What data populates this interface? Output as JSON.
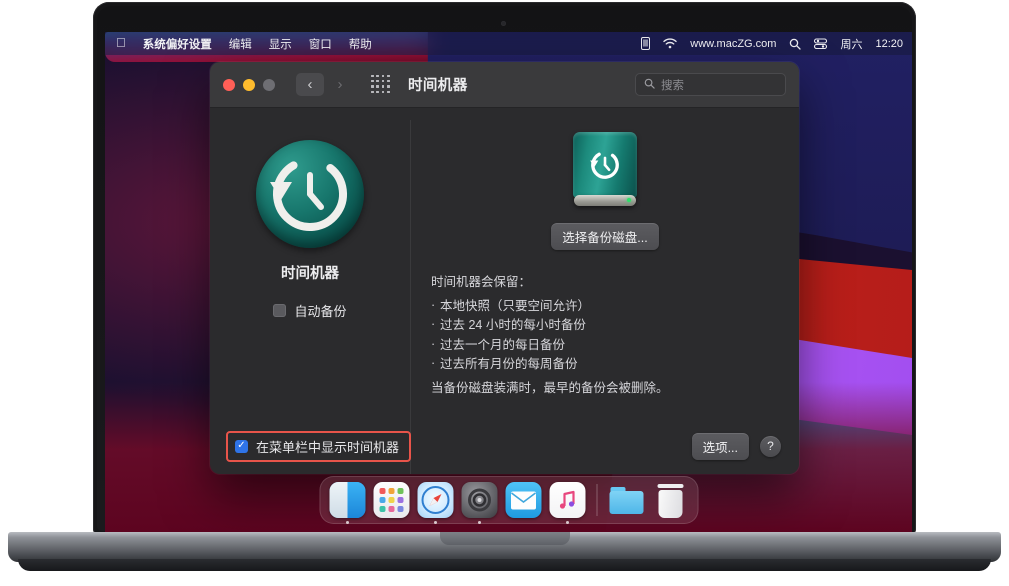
{
  "device": {
    "bezel_brand": "MacZG.com"
  },
  "menubar": {
    "apple_glyph": "",
    "left_items": [
      {
        "label": "系统偏好设置",
        "bold": true
      },
      {
        "label": "编辑",
        "bold": false
      },
      {
        "label": "显示",
        "bold": false
      },
      {
        "label": "窗口",
        "bold": false
      },
      {
        "label": "帮助",
        "bold": false
      }
    ],
    "right": {
      "screen_icon": "display-icon",
      "wifi_icon": "wifi-icon",
      "site": "www.macZG.com",
      "search_icon": "spotlight-search-icon",
      "control_center_icon": "control-center-icon",
      "day": "周六",
      "time": "12:20"
    }
  },
  "window": {
    "title": "时间机器",
    "traffic_lights": [
      "close",
      "minimize",
      "zoom"
    ],
    "nav": {
      "back": "‹",
      "forward": "›",
      "grid": "show-all-icon"
    },
    "search": {
      "placeholder": "搜索",
      "value": ""
    },
    "left": {
      "app_icon": "time-machine-icon",
      "app_name": "时间机器",
      "auto_backup": {
        "label": "自动备份",
        "checked": false
      }
    },
    "right": {
      "disk_icon": "backup-disk-icon",
      "select_disk_button": "选择备份磁盘...",
      "keep_heading": "时间机器会保留：",
      "keep_items": [
        "本地快照（只要空间允许）",
        "过去 24 小时的每小时备份",
        "过去一个月的每日备份",
        "过去所有月份的每周备份"
      ],
      "keep_footer": "当备份磁盘装满时，最早的备份会被删除。"
    },
    "footer": {
      "menubar_checkbox": {
        "label": "在菜单栏中显示时间机器",
        "checked": true,
        "checkmark": "✓",
        "highlighted": true
      },
      "options_button": "选项...",
      "help_button": "?"
    }
  },
  "dock": {
    "items": [
      {
        "name": "finder",
        "running": true
      },
      {
        "name": "launchpad",
        "running": false
      },
      {
        "name": "safari",
        "running": true
      },
      {
        "name": "system-preferences",
        "running": true
      },
      {
        "name": "mail",
        "running": false
      },
      {
        "name": "music",
        "running": true
      },
      {
        "name": "downloads-folder",
        "running": false
      },
      {
        "name": "trash",
        "running": false
      }
    ]
  },
  "colors": {
    "accent_blue": "#2f74e8",
    "highlight_red": "#e8544a",
    "time_machine_teal": "#17766c",
    "window_bg": "#2b2b2d",
    "titlebar_bg": "#3a3a3c"
  }
}
